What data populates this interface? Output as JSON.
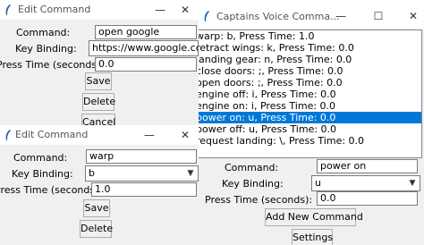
{
  "window1": {
    "title": "Edit Command",
    "command_label": "Command:",
    "command_value": "open google",
    "key_binding_label": "Key Binding:",
    "key_binding_value": "https://www.google.co",
    "press_time_label": "Press Time (seconds):",
    "press_time_value": "0.0",
    "save_label": "Save",
    "delete_label": "Delete",
    "cancel_label": "Cancel"
  },
  "main_window": {
    "title": "Captains Voice Comma...",
    "commands": [
      "warp: b, Press Time: 1.0",
      "retract wings: k, Press Time: 0.0",
      "landing gear: n, Press Time: 0.0",
      "close doors: ;, Press Time: 0.0",
      "open doors: ;, Press Time: 0.0",
      "engine off: i, Press Time: 0.0",
      "engine on: i, Press Time: 0.0",
      "power on: u, Press Time: 0.0",
      "power off: u, Press Time: 0.0",
      "request landing: \\, Press Time: 0.0"
    ],
    "selected_index": 7,
    "command_label": "Command:",
    "command_value": "power on",
    "key_binding_label": "Key Binding:",
    "key_binding_value": "u",
    "press_time_label": "Press Time (seconds):",
    "press_time_value": "0.0",
    "add_button_label": "Add New Command",
    "settings_button_label": "Settings"
  },
  "window2": {
    "title": "Edit Command",
    "command_label": "Command:",
    "command_value": "warp",
    "key_binding_label": "Key Binding:",
    "key_binding_value": "b",
    "press_time_label": "Press Time (seconds):",
    "press_time_value": "1.0",
    "save_label": "Save",
    "delete_label": "Delete"
  },
  "colors": {
    "selection": "#0078d7",
    "window_bg": "#f0f0f0",
    "titlebar_bg": "#ffffff"
  },
  "icons": [
    "feather-icon",
    "minimize-icon",
    "maximize-icon",
    "close-icon",
    "chevron-down-icon"
  ]
}
